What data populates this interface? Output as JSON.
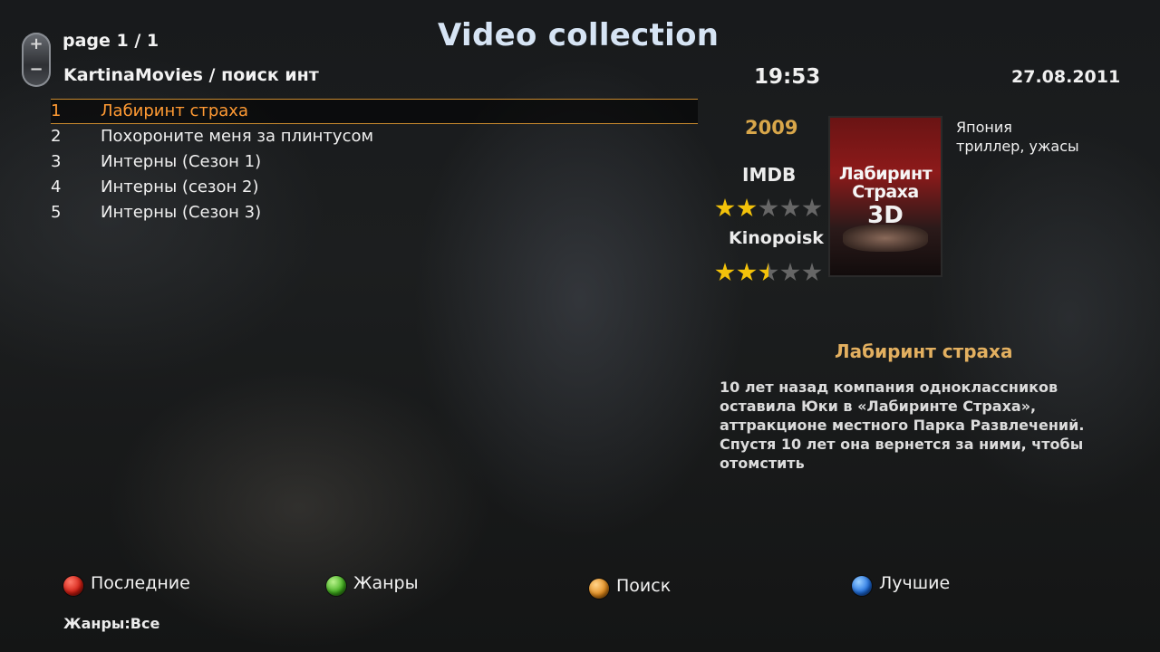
{
  "header": {
    "page_indicator": "page 1 / 1",
    "breadcrumb": "KartinaMovies / поиск инт",
    "title": "Video collection",
    "clock": "19:53",
    "date": "27.08.2011"
  },
  "pager_control": {
    "plus_icon": "+",
    "minus_icon": "−"
  },
  "movies": [
    {
      "num": "1",
      "title": "Лабиринт страха",
      "selected": true
    },
    {
      "num": "2",
      "title": "Похороните меня за плинтусом",
      "selected": false
    },
    {
      "num": "3",
      "title": "Интерны  (Сезон 1)",
      "selected": false
    },
    {
      "num": "4",
      "title": "Интерны  (сезон 2)",
      "selected": false
    },
    {
      "num": "5",
      "title": "Интерны  (Сезон 3)",
      "selected": false
    }
  ],
  "details": {
    "year": "2009",
    "imdb_label": "IMDB",
    "imdb_rating_stars": 2,
    "kinopoisk_label": "Kinopoisk",
    "kinopoisk_rating_stars": 2.5,
    "max_stars": 5,
    "country": "Япония",
    "genres": "триллер, ужасы",
    "title": "Лабиринт страха",
    "description": "10 лет назад компания одноклассников оставила Юки в «Лабиринте Страха», аттракционе местного Парка Развлечений. Спустя 10 лет она вернется за ними, чтобы отомстить",
    "poster": {
      "top_text": "",
      "title_line1": "Лабиринт",
      "title_line2": "Страха",
      "title_3d": "3D"
    }
  },
  "buttons": {
    "red": "Последние",
    "green": "Жанры",
    "yellow": "Поиск",
    "blue": "Лучшие"
  },
  "footer": {
    "genre_filter": "Жанры:Все"
  },
  "colors": {
    "accent_orange": "#ff9a33",
    "year_gold": "#d8a64a",
    "title_gold": "#e3b060",
    "star_on": "#f3c20a",
    "star_off": "#666666",
    "header_title": "#d6e4f4"
  }
}
